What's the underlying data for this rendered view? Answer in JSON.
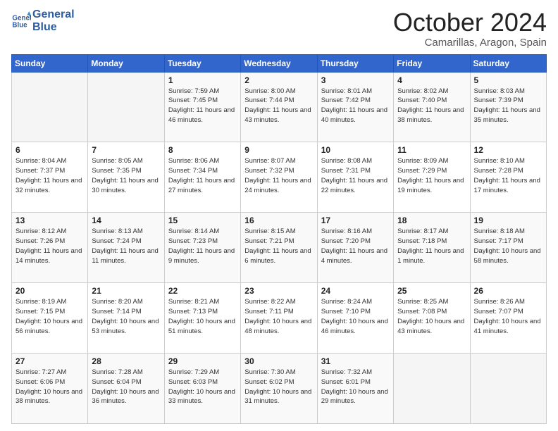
{
  "header": {
    "logo_line1": "General",
    "logo_line2": "Blue",
    "month": "October 2024",
    "location": "Camarillas, Aragon, Spain"
  },
  "weekdays": [
    "Sunday",
    "Monday",
    "Tuesday",
    "Wednesday",
    "Thursday",
    "Friday",
    "Saturday"
  ],
  "weeks": [
    [
      {
        "day": "",
        "info": ""
      },
      {
        "day": "",
        "info": ""
      },
      {
        "day": "1",
        "info": "Sunrise: 7:59 AM\nSunset: 7:45 PM\nDaylight: 11 hours and 46 minutes."
      },
      {
        "day": "2",
        "info": "Sunrise: 8:00 AM\nSunset: 7:44 PM\nDaylight: 11 hours and 43 minutes."
      },
      {
        "day": "3",
        "info": "Sunrise: 8:01 AM\nSunset: 7:42 PM\nDaylight: 11 hours and 40 minutes."
      },
      {
        "day": "4",
        "info": "Sunrise: 8:02 AM\nSunset: 7:40 PM\nDaylight: 11 hours and 38 minutes."
      },
      {
        "day": "5",
        "info": "Sunrise: 8:03 AM\nSunset: 7:39 PM\nDaylight: 11 hours and 35 minutes."
      }
    ],
    [
      {
        "day": "6",
        "info": "Sunrise: 8:04 AM\nSunset: 7:37 PM\nDaylight: 11 hours and 32 minutes."
      },
      {
        "day": "7",
        "info": "Sunrise: 8:05 AM\nSunset: 7:35 PM\nDaylight: 11 hours and 30 minutes."
      },
      {
        "day": "8",
        "info": "Sunrise: 8:06 AM\nSunset: 7:34 PM\nDaylight: 11 hours and 27 minutes."
      },
      {
        "day": "9",
        "info": "Sunrise: 8:07 AM\nSunset: 7:32 PM\nDaylight: 11 hours and 24 minutes."
      },
      {
        "day": "10",
        "info": "Sunrise: 8:08 AM\nSunset: 7:31 PM\nDaylight: 11 hours and 22 minutes."
      },
      {
        "day": "11",
        "info": "Sunrise: 8:09 AM\nSunset: 7:29 PM\nDaylight: 11 hours and 19 minutes."
      },
      {
        "day": "12",
        "info": "Sunrise: 8:10 AM\nSunset: 7:28 PM\nDaylight: 11 hours and 17 minutes."
      }
    ],
    [
      {
        "day": "13",
        "info": "Sunrise: 8:12 AM\nSunset: 7:26 PM\nDaylight: 11 hours and 14 minutes."
      },
      {
        "day": "14",
        "info": "Sunrise: 8:13 AM\nSunset: 7:24 PM\nDaylight: 11 hours and 11 minutes."
      },
      {
        "day": "15",
        "info": "Sunrise: 8:14 AM\nSunset: 7:23 PM\nDaylight: 11 hours and 9 minutes."
      },
      {
        "day": "16",
        "info": "Sunrise: 8:15 AM\nSunset: 7:21 PM\nDaylight: 11 hours and 6 minutes."
      },
      {
        "day": "17",
        "info": "Sunrise: 8:16 AM\nSunset: 7:20 PM\nDaylight: 11 hours and 4 minutes."
      },
      {
        "day": "18",
        "info": "Sunrise: 8:17 AM\nSunset: 7:18 PM\nDaylight: 11 hours and 1 minute."
      },
      {
        "day": "19",
        "info": "Sunrise: 8:18 AM\nSunset: 7:17 PM\nDaylight: 10 hours and 58 minutes."
      }
    ],
    [
      {
        "day": "20",
        "info": "Sunrise: 8:19 AM\nSunset: 7:15 PM\nDaylight: 10 hours and 56 minutes."
      },
      {
        "day": "21",
        "info": "Sunrise: 8:20 AM\nSunset: 7:14 PM\nDaylight: 10 hours and 53 minutes."
      },
      {
        "day": "22",
        "info": "Sunrise: 8:21 AM\nSunset: 7:13 PM\nDaylight: 10 hours and 51 minutes."
      },
      {
        "day": "23",
        "info": "Sunrise: 8:22 AM\nSunset: 7:11 PM\nDaylight: 10 hours and 48 minutes."
      },
      {
        "day": "24",
        "info": "Sunrise: 8:24 AM\nSunset: 7:10 PM\nDaylight: 10 hours and 46 minutes."
      },
      {
        "day": "25",
        "info": "Sunrise: 8:25 AM\nSunset: 7:08 PM\nDaylight: 10 hours and 43 minutes."
      },
      {
        "day": "26",
        "info": "Sunrise: 8:26 AM\nSunset: 7:07 PM\nDaylight: 10 hours and 41 minutes."
      }
    ],
    [
      {
        "day": "27",
        "info": "Sunrise: 7:27 AM\nSunset: 6:06 PM\nDaylight: 10 hours and 38 minutes."
      },
      {
        "day": "28",
        "info": "Sunrise: 7:28 AM\nSunset: 6:04 PM\nDaylight: 10 hours and 36 minutes."
      },
      {
        "day": "29",
        "info": "Sunrise: 7:29 AM\nSunset: 6:03 PM\nDaylight: 10 hours and 33 minutes."
      },
      {
        "day": "30",
        "info": "Sunrise: 7:30 AM\nSunset: 6:02 PM\nDaylight: 10 hours and 31 minutes."
      },
      {
        "day": "31",
        "info": "Sunrise: 7:32 AM\nSunset: 6:01 PM\nDaylight: 10 hours and 29 minutes."
      },
      {
        "day": "",
        "info": ""
      },
      {
        "day": "",
        "info": ""
      }
    ]
  ]
}
